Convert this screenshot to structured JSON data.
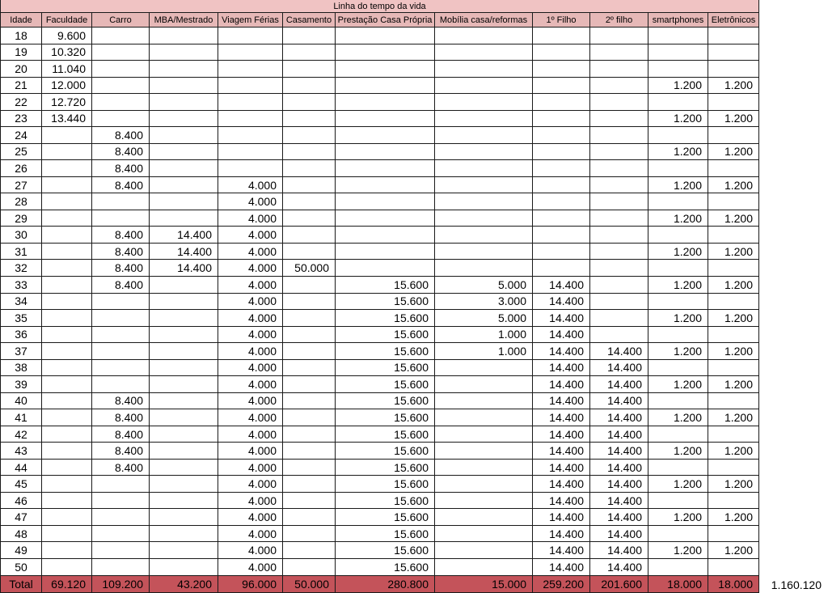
{
  "sheet": {
    "title": "Linha do tempo da vida",
    "columns": [
      "Idade",
      "Faculdade",
      "Carro",
      "MBA/Mestrado",
      "Viagem Férias",
      "Casamento",
      "Prestação Casa Própria",
      "Mobília casa/reformas",
      "1º Filho",
      "2º filho",
      "smartphones",
      "Eletrônicos"
    ],
    "rows": [
      [
        "18",
        "9.600",
        "",
        "",
        "",
        "",
        "",
        "",
        "",
        "",
        "",
        ""
      ],
      [
        "19",
        "10.320",
        "",
        "",
        "",
        "",
        "",
        "",
        "",
        "",
        "",
        ""
      ],
      [
        "20",
        "11.040",
        "",
        "",
        "",
        "",
        "",
        "",
        "",
        "",
        "",
        ""
      ],
      [
        "21",
        "12.000",
        "",
        "",
        "",
        "",
        "",
        "",
        "",
        "",
        "1.200",
        "1.200"
      ],
      [
        "22",
        "12.720",
        "",
        "",
        "",
        "",
        "",
        "",
        "",
        "",
        "",
        ""
      ],
      [
        "23",
        "13.440",
        "",
        "",
        "",
        "",
        "",
        "",
        "",
        "",
        "1.200",
        "1.200"
      ],
      [
        "24",
        "",
        "8.400",
        "",
        "",
        "",
        "",
        "",
        "",
        "",
        "",
        ""
      ],
      [
        "25",
        "",
        "8.400",
        "",
        "",
        "",
        "",
        "",
        "",
        "",
        "1.200",
        "1.200"
      ],
      [
        "26",
        "",
        "8.400",
        "",
        "",
        "",
        "",
        "",
        "",
        "",
        "",
        ""
      ],
      [
        "27",
        "",
        "8.400",
        "",
        "4.000",
        "",
        "",
        "",
        "",
        "",
        "1.200",
        "1.200"
      ],
      [
        "28",
        "",
        "",
        "",
        "4.000",
        "",
        "",
        "",
        "",
        "",
        "",
        ""
      ],
      [
        "29",
        "",
        "",
        "",
        "4.000",
        "",
        "",
        "",
        "",
        "",
        "1.200",
        "1.200"
      ],
      [
        "30",
        "",
        "8.400",
        "14.400",
        "4.000",
        "",
        "",
        "",
        "",
        "",
        "",
        ""
      ],
      [
        "31",
        "",
        "8.400",
        "14.400",
        "4.000",
        "",
        "",
        "",
        "",
        "",
        "1.200",
        "1.200"
      ],
      [
        "32",
        "",
        "8.400",
        "14.400",
        "4.000",
        "50.000",
        "",
        "",
        "",
        "",
        "",
        ""
      ],
      [
        "33",
        "",
        "8.400",
        "",
        "4.000",
        "",
        "15.600",
        "5.000",
        "14.400",
        "",
        "1.200",
        "1.200"
      ],
      [
        "34",
        "",
        "",
        "",
        "4.000",
        "",
        "15.600",
        "3.000",
        "14.400",
        "",
        "",
        ""
      ],
      [
        "35",
        "",
        "",
        "",
        "4.000",
        "",
        "15.600",
        "5.000",
        "14.400",
        "",
        "1.200",
        "1.200"
      ],
      [
        "36",
        "",
        "",
        "",
        "4.000",
        "",
        "15.600",
        "1.000",
        "14.400",
        "",
        "",
        ""
      ],
      [
        "37",
        "",
        "",
        "",
        "4.000",
        "",
        "15.600",
        "1.000",
        "14.400",
        "14.400",
        "1.200",
        "1.200"
      ],
      [
        "38",
        "",
        "",
        "",
        "4.000",
        "",
        "15.600",
        "",
        "14.400",
        "14.400",
        "",
        ""
      ],
      [
        "39",
        "",
        "",
        "",
        "4.000",
        "",
        "15.600",
        "",
        "14.400",
        "14.400",
        "1.200",
        "1.200"
      ],
      [
        "40",
        "",
        "8.400",
        "",
        "4.000",
        "",
        "15.600",
        "",
        "14.400",
        "14.400",
        "",
        ""
      ],
      [
        "41",
        "",
        "8.400",
        "",
        "4.000",
        "",
        "15.600",
        "",
        "14.400",
        "14.400",
        "1.200",
        "1.200"
      ],
      [
        "42",
        "",
        "8.400",
        "",
        "4.000",
        "",
        "15.600",
        "",
        "14.400",
        "14.400",
        "",
        ""
      ],
      [
        "43",
        "",
        "8.400",
        "",
        "4.000",
        "",
        "15.600",
        "",
        "14.400",
        "14.400",
        "1.200",
        "1.200"
      ],
      [
        "44",
        "",
        "8.400",
        "",
        "4.000",
        "",
        "15.600",
        "",
        "14.400",
        "14.400",
        "",
        ""
      ],
      [
        "45",
        "",
        "",
        "",
        "4.000",
        "",
        "15.600",
        "",
        "14.400",
        "14.400",
        "1.200",
        "1.200"
      ],
      [
        "46",
        "",
        "",
        "",
        "4.000",
        "",
        "15.600",
        "",
        "14.400",
        "14.400",
        "",
        ""
      ],
      [
        "47",
        "",
        "",
        "",
        "4.000",
        "",
        "15.600",
        "",
        "14.400",
        "14.400",
        "1.200",
        "1.200"
      ],
      [
        "48",
        "",
        "",
        "",
        "4.000",
        "",
        "15.600",
        "",
        "14.400",
        "14.400",
        "",
        ""
      ],
      [
        "49",
        "",
        "",
        "",
        "4.000",
        "",
        "15.600",
        "",
        "14.400",
        "14.400",
        "1.200",
        "1.200"
      ],
      [
        "50",
        "",
        "",
        "",
        "4.000",
        "",
        "15.600",
        "",
        "14.400",
        "14.400",
        "",
        ""
      ]
    ],
    "total": [
      "Total",
      "69.120",
      "109.200",
      "43.200",
      "96.000",
      "50.000",
      "280.800",
      "15.000",
      "259.200",
      "201.600",
      "18.000",
      "18.000"
    ]
  },
  "grand_total": "1.160.120",
  "colors": {
    "title_bg": "#f0c3c3",
    "header_bg": "#e6b8b7",
    "total_bg": "#c4535a",
    "grid_line": "#1a1a1a"
  }
}
